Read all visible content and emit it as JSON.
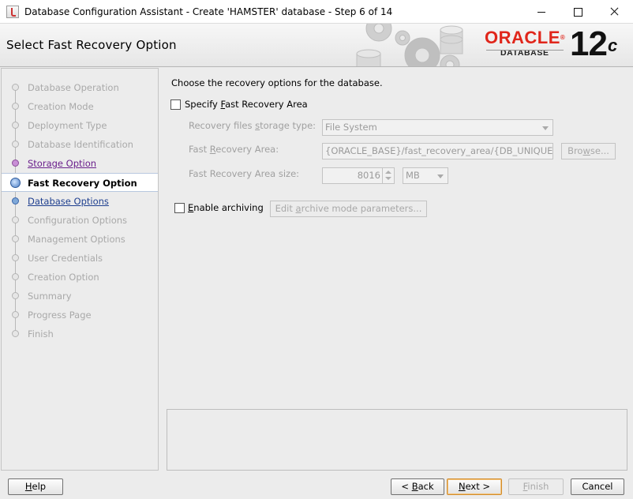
{
  "window": {
    "title": "Database Configuration Assistant - Create 'HAMSTER' database - Step 6 of 14",
    "minimize_label": "",
    "maximize_label": "",
    "close_label": ""
  },
  "header": {
    "page_title": "Select Fast Recovery Option",
    "logo_word": "ORACLE",
    "logo_trademark": "®",
    "logo_sub": "DATABASE",
    "logo_version": "12",
    "logo_version_suffix": "c"
  },
  "sidebar": {
    "steps": [
      {
        "label": "Database Operation",
        "state": "disabled"
      },
      {
        "label": "Creation Mode",
        "state": "disabled"
      },
      {
        "label": "Deployment Type",
        "state": "disabled"
      },
      {
        "label": "Database Identification",
        "state": "disabled"
      },
      {
        "label": "Storage Option",
        "state": "visited"
      },
      {
        "label": "Fast Recovery Option",
        "state": "current"
      },
      {
        "label": "Database Options",
        "state": "next"
      },
      {
        "label": "Configuration Options",
        "state": "disabled"
      },
      {
        "label": "Management Options",
        "state": "disabled"
      },
      {
        "label": "User Credentials",
        "state": "disabled"
      },
      {
        "label": "Creation Option",
        "state": "disabled"
      },
      {
        "label": "Summary",
        "state": "disabled"
      },
      {
        "label": "Progress Page",
        "state": "disabled"
      },
      {
        "label": "Finish",
        "state": "disabled"
      }
    ]
  },
  "main": {
    "intro": "Choose the recovery options for the database.",
    "specify_fra": {
      "label_pre": "Specify ",
      "label_mnemonic": "F",
      "label_post": "ast Recovery Area",
      "checked": false
    },
    "storage_type": {
      "label_pre": "Recovery files ",
      "label_mnemonic": "s",
      "label_post": "torage type:",
      "value": "File System"
    },
    "fra_path": {
      "label_pre": "Fast ",
      "label_mnemonic": "R",
      "label_post": "ecovery Area:",
      "value": "{ORACLE_BASE}/fast_recovery_area/{DB_UNIQUE_",
      "browse_pre": "Bro",
      "browse_mnemonic": "w",
      "browse_post": "se..."
    },
    "fra_size": {
      "label": "Fast Recovery Area size:",
      "value": "8016",
      "unit": "MB"
    },
    "archiving": {
      "label_pre": "",
      "label_mnemonic": "E",
      "label_post": "nable archiving",
      "checked": false,
      "edit_pre": "Edit ",
      "edit_mnemonic": "a",
      "edit_post": "rchive mode parameters..."
    },
    "messages": ""
  },
  "footer": {
    "help": {
      "pre": "",
      "mnemonic": "H",
      "post": "elp"
    },
    "back": {
      "pre": "< ",
      "mnemonic": "B",
      "post": "ack"
    },
    "next": {
      "pre": "",
      "mnemonic": "N",
      "post": "ext >"
    },
    "finish": {
      "pre": "",
      "mnemonic": "F",
      "post": "inish"
    },
    "cancel": {
      "label": "Cancel"
    }
  },
  "colors": {
    "oracle_red": "#e0261b",
    "visited_link": "#6a1f8c",
    "next_link": "#1e3f8f",
    "default_button_border": "#d28d2d"
  }
}
